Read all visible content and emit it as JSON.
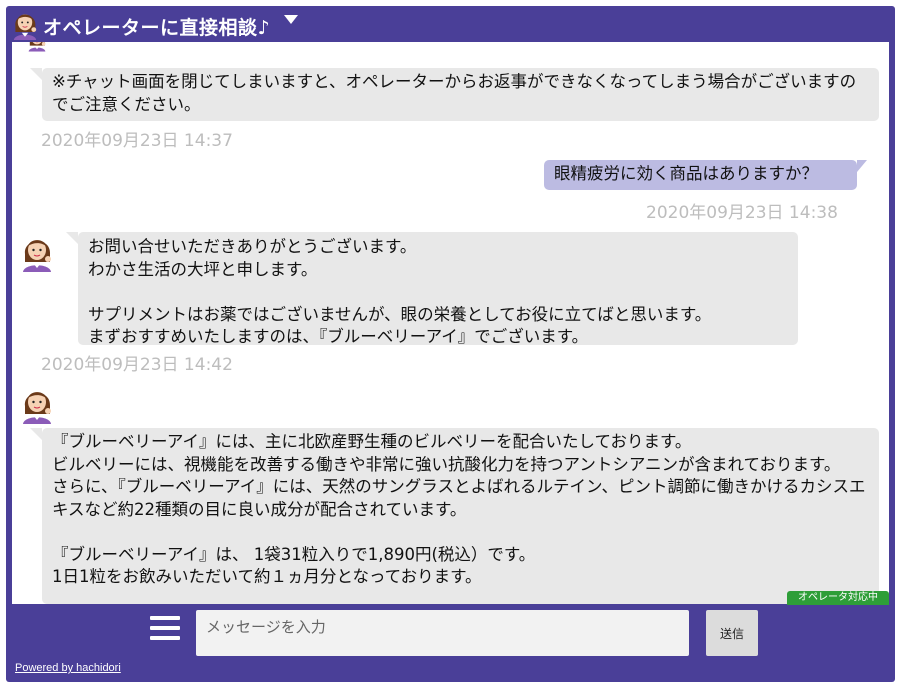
{
  "header": {
    "title": "オペレーターに直接相談♪",
    "avatar_icon": "operator-avatar-icon",
    "collapse_icon": "caret-down-icon"
  },
  "messages": [
    {
      "sender": "operator",
      "text": "※チャット画面を閉じてしまいますと、オペレーターからお返事ができなくなってしまう場合がございますのでご注意ください。",
      "time": "2020年09月23日 14:37"
    },
    {
      "sender": "user",
      "text": "眼精疲労に効く商品はありますか？",
      "time": "2020年09月23日 14:38"
    },
    {
      "sender": "operator",
      "text": "お問い合せいただきありがとうございます。\nわかさ生活の大坪と申します。\n\nサプリメントはお薬ではございませんが、眼の栄養としてお役に立てばと思います。\nまずおすすめいたしますのは、『ブルーベリーアイ』でございます。",
      "time": "2020年09月23日 14:42"
    },
    {
      "sender": "operator",
      "text": "『ブルーベリーアイ』には、主に北欧産野生種のビルベリーを配合いたしております。\nビルベリーには、視機能を改善する働きや非常に強い抗酸化力を持つアントシアニンが含まれております。\nさらに、『ブルーベリーアイ』には、天然のサングラスとよばれるルテイン、ピント調節に働きかけるカシスエキスなど約22種類の目に良い成分が配合されています。\n\n『ブルーベリーアイ』は、 1袋31粒入りで1,890円(税込）です。\n1日1粒をお飲みいただいて約１ヵ月分となっております。",
      "time": ""
    }
  ],
  "status_badge": "オペレータ対応中",
  "composer": {
    "placeholder": "メッセージを入力",
    "send_label": "送信",
    "menu_icon": "hamburger-menu-icon"
  },
  "footer": {
    "powered_by": "Powered by hachidori"
  },
  "colors": {
    "frame": "#4a3f98",
    "operator_bubble": "#e8e8e8",
    "user_bubble": "#bcbbe2",
    "timestamp": "#bdbdbd",
    "status_badge": "#2e9e38"
  }
}
